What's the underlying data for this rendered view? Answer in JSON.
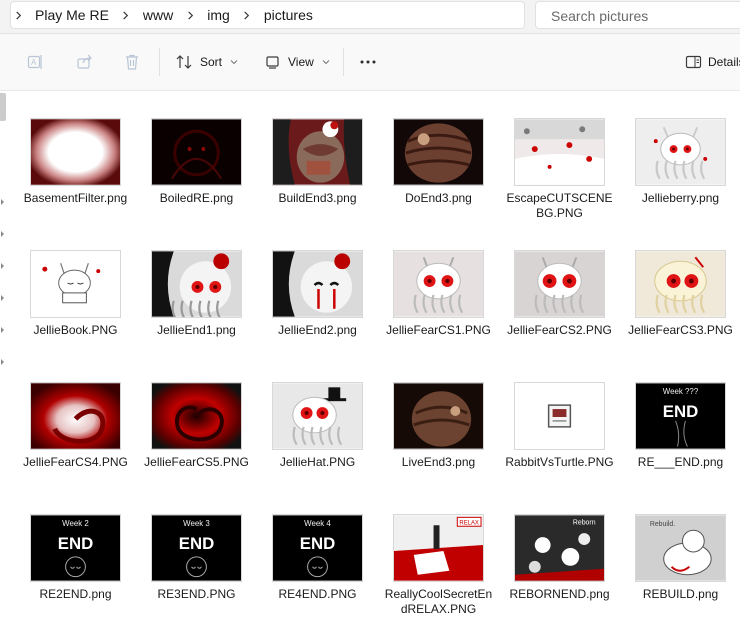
{
  "breadcrumb": [
    "Play Me RE",
    "www",
    "img",
    "pictures"
  ],
  "search": {
    "placeholder": "Search pictures"
  },
  "toolbar": {
    "sort_label": "Sort",
    "view_label": "View",
    "details_label": "Details"
  },
  "files": [
    {
      "name": "BasementFilter.png",
      "thumb": "basement"
    },
    {
      "name": "BoiledRE.png",
      "thumb": "boiled"
    },
    {
      "name": "BuildEnd3.png",
      "thumb": "buildend3"
    },
    {
      "name": "DoEnd3.png",
      "thumb": "doend3"
    },
    {
      "name": "EscapeCUTSCENEBG.PNG",
      "thumb": "escape"
    },
    {
      "name": "Jellieberry.png",
      "thumb": "jellieberry"
    },
    {
      "name": "JellieBook.PNG",
      "thumb": "jelliebook"
    },
    {
      "name": "JellieEnd1.png",
      "thumb": "jellieend1"
    },
    {
      "name": "JellieEnd2.png",
      "thumb": "jellieend2"
    },
    {
      "name": "JellieFearCS1.PNG",
      "thumb": "fear1"
    },
    {
      "name": "JellieFearCS2.PNG",
      "thumb": "fear2"
    },
    {
      "name": "JellieFearCS3.PNG",
      "thumb": "fear3"
    },
    {
      "name": "JellieFearCS4.PNG",
      "thumb": "fear4"
    },
    {
      "name": "JellieFearCS5.PNG",
      "thumb": "fear5"
    },
    {
      "name": "JellieHat.PNG",
      "thumb": "jelliehat"
    },
    {
      "name": "LiveEnd3.png",
      "thumb": "liveend3"
    },
    {
      "name": "RabbitVsTurtle.PNG",
      "thumb": "rabbit"
    },
    {
      "name": "RE___END.png",
      "thumb": "reend",
      "caption": "Week ???"
    },
    {
      "name": "RE2END.png",
      "thumb": "week",
      "caption": "Week 2"
    },
    {
      "name": "RE3END.PNG",
      "thumb": "week",
      "caption": "Week 3"
    },
    {
      "name": "RE4END.PNG",
      "thumb": "week",
      "caption": "Week 4"
    },
    {
      "name": "ReallyCoolSecretEndRELAX.PNG",
      "thumb": "relax",
      "caption": "RELAX"
    },
    {
      "name": "REBORNEND.png",
      "thumb": "reborn",
      "caption": "Reborn"
    },
    {
      "name": "REBUILD.png",
      "thumb": "rebuild",
      "caption": "Rebuild."
    }
  ],
  "thumb_word": "END"
}
